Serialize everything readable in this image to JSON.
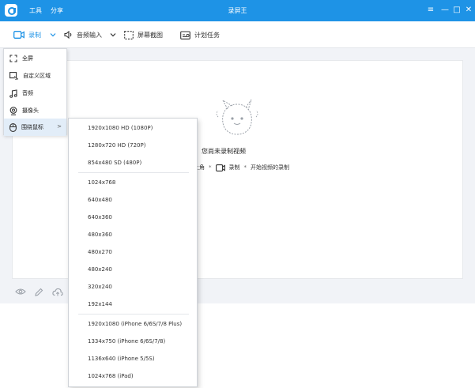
{
  "titlebar": {
    "title": "录屏王",
    "menu": [
      "工具",
      "分享"
    ],
    "buttons": [
      "≡",
      "—",
      "□",
      "✕"
    ]
  },
  "toolbar": {
    "record": "录制",
    "audio": "音频输入",
    "screenshot": "屏幕截图",
    "schedule": "计划任务"
  },
  "empty_state": {
    "title": "您尚未录制视频",
    "hint_prefix": "上角",
    "hint_record": "录制",
    "hint_suffix": "开始视频的录制",
    "separator": "*"
  },
  "record_menu": [
    {
      "label": "全屏",
      "icon": "fullscreen-icon"
    },
    {
      "label": "自定义区域",
      "icon": "custom-area-icon"
    },
    {
      "label": "音频",
      "icon": "music-icon"
    },
    {
      "label": "摄像头",
      "icon": "webcam-icon"
    },
    {
      "label": "围绕鼠标",
      "icon": "mouse-icon",
      "active": true,
      "arrow": ">"
    }
  ],
  "resolutions": [
    "1920x1080 HD (1080P)",
    "1280x720 HD (720P)",
    "854x480 SD (480P)",
    "1024x768",
    "640x480",
    "640x360",
    "480x360",
    "480x270",
    "480x240",
    "320x240",
    "192x144",
    "1920x1080 (iPhone 6/6S/7/8 Plus)",
    "1334x750 (iPhone 6/6S/7/8)",
    "1136x640 (iPhone 5/5S)",
    "1024x768 (iPad)"
  ],
  "colors": {
    "titlebar": "#1e93e6",
    "accent": "#1e93e6",
    "active_item": "#e2edf8"
  }
}
